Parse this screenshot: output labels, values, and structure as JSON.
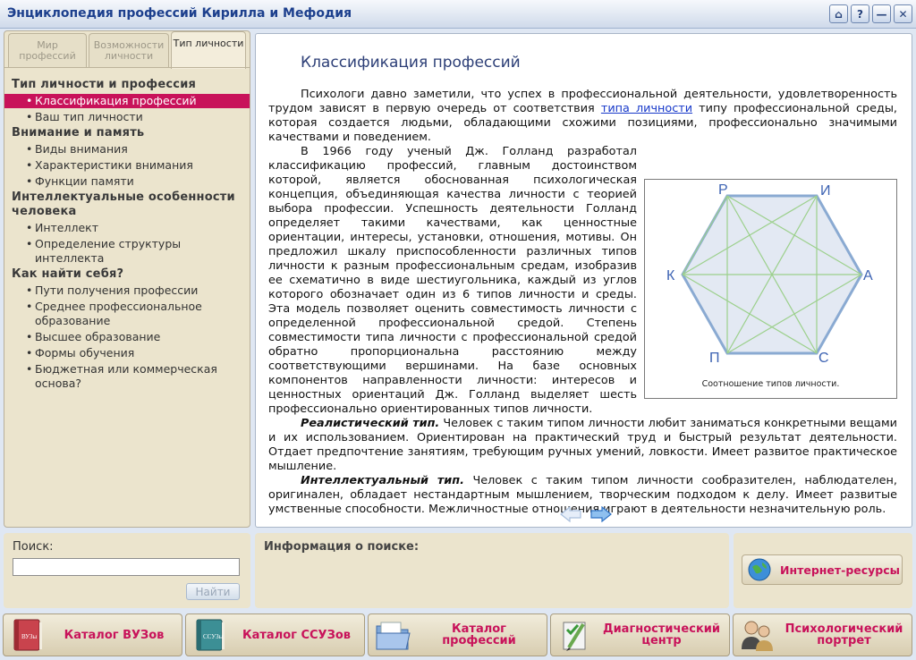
{
  "window": {
    "title": "Энциклопедия профессий Кирилла и Мефодия",
    "controls": [
      "⌂",
      "?",
      "—",
      "✕"
    ]
  },
  "sidebar": {
    "tabs": [
      {
        "label": "Мир профессий"
      },
      {
        "label": "Возможности личности"
      },
      {
        "label": "Тип личности"
      }
    ],
    "groups": [
      {
        "title": "Тип личности и профессия",
        "items": [
          "Классификация профессий",
          "Ваш тип личности"
        ]
      },
      {
        "title": "Внимание и память",
        "items": [
          "Виды внимания",
          "Характеристики внимания",
          "Функции памяти"
        ]
      },
      {
        "title": "Интеллектуальные особенности человека",
        "items": [
          "Интеллект",
          "Определение структуры интеллекта"
        ]
      },
      {
        "title": "Как найти себя?",
        "items": [
          "Пути получения профессии",
          "Среднее профессиональное образование",
          "Высшее образование",
          "Формы обучения",
          "Бюджетная или коммерческая основа?"
        ]
      }
    ],
    "active_item": "Классификация профессий"
  },
  "article": {
    "title": "Классификация профессий",
    "p1_before": "Психологи давно заметили, что успех в профессиональной деятельности, удовлетворенность трудом зависят в первую очередь от соответствия ",
    "p1_link": "типа личности",
    "p1_after": " типу профессиональной среды, которая создается людьми, обладающими схожими позициями, профессионально значимыми качествами и поведением.",
    "p2": "В 1966 году ученый Дж. Голланд разработал классификацию профессий, главным достоинством которой, является обоснованная психологическая концепция, объединяющая качества личности с теорией выбора профессии. Успешность деятельности Голланд определяет такими качествами, как ценностные ориентации, интересы, установки, отношения, мотивы. Он предложил шкалу приспособленности различных типов личности к разным профессиональным средам, изобразив ее схематично в виде шестиугольника, каждый из углов которого обозначает один из 6 типов личности и среды. Эта модель позволяет оценить совместимость личности с определенной профессиональной средой. Степень совместимости типа личности с профессиональной средой обратно пропорциональна расстоянию между соответствующими вершинами. На базе основных компонентов направленности личности: интересов и ценностных ориентаций Дж. Голланд выделяет шесть профессионально ориентированных типов личности.",
    "p3_bold": "Реалистический тип.",
    "p3": " Человек с таким типом личности любит заниматься конкретными вещами и их использованием. Ориентирован на практический труд и быстрый результат деятельности. Отдает предпочтение занятиям, требующим ручных умений, ловкости. Имеет развитое практическое мышление.",
    "p4_bold": "Интеллектуальный тип.",
    "p4": " Человек с таким типом личности сообразителен, наблюдателен, оригинален, обладает нестандартным мышлением, творческим подходом к делу. Имеет развитые умственные способности. Межличностные отношения играют в деятельности незначительную роль.",
    "figure": {
      "vertex_labels": {
        "top_left": "Р",
        "top_right": "И",
        "left": "К",
        "right": "А",
        "bottom_left": "П",
        "bottom_right": "С"
      },
      "caption": "Соотношение типов личности.",
      "hex_color": "#8aaad2",
      "line_color": "#9cd08c"
    },
    "nav": {
      "prev": "arrow-left",
      "next": "arrow-right"
    }
  },
  "search": {
    "label": "Поиск:",
    "value": "",
    "button": "Найти"
  },
  "info": {
    "title": "Информация о поиске:"
  },
  "internet": {
    "label": "Интернет-ресурсы"
  },
  "bottom_buttons": [
    {
      "label": "Каталог ВУЗов",
      "icon": "book-red-icon"
    },
    {
      "label": "Каталог ССУЗов",
      "icon": "book-teal-icon"
    },
    {
      "label": "Каталог профессий",
      "icon": "folder-icon"
    },
    {
      "label": "Диагностический центр",
      "icon": "checklist-icon"
    },
    {
      "label": "Психологический портрет",
      "icon": "people-icon"
    }
  ],
  "colors": {
    "accent": "#c8125a",
    "title": "#1c3f8d",
    "panel": "#ebe4cd"
  }
}
